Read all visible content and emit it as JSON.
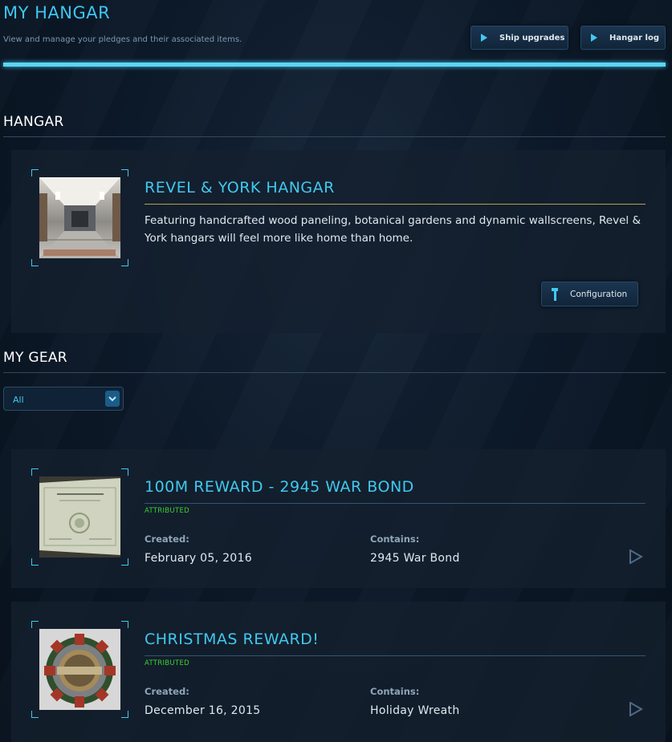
{
  "header": {
    "title": "MY HANGAR",
    "subtitle": "View and manage your pledges and their associated items.",
    "buttons": [
      {
        "label": "Ship upgrades",
        "icon": "play-icon"
      },
      {
        "label": "Hangar log",
        "icon": "play-icon"
      }
    ]
  },
  "hangar": {
    "heading": "HANGAR",
    "item": {
      "title": "REVEL & YORK HANGAR",
      "description": "Featuring handcrafted wood paneling, botanical gardens and dynamic wallscreens, Revel & York hangars will feel more like home than home.",
      "config_button": {
        "label": "Configuration",
        "icon": "wrench-icon"
      }
    }
  },
  "gear": {
    "heading": "MY GEAR",
    "filter": {
      "selected": "All"
    },
    "items": [
      {
        "title": "100M REWARD - 2945 WAR BOND",
        "status": "ATTRIBUTED",
        "created_label": "Created:",
        "created": "February 05, 2016",
        "contains_label": "Contains:",
        "contains": "2945 War Bond"
      },
      {
        "title": "CHRISTMAS REWARD!",
        "status": "ATTRIBUTED",
        "created_label": "Created:",
        "created": "December 16, 2015",
        "contains_label": "Contains:",
        "contains": "Holiday Wreath"
      }
    ]
  },
  "colors": {
    "accent": "#41c8ee",
    "attributed": "#3bd12f",
    "background": "#0d1a2a"
  }
}
